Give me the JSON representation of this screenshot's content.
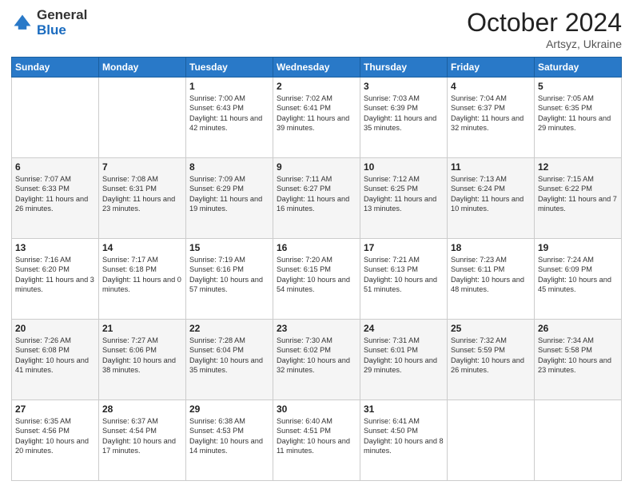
{
  "header": {
    "logo_general": "General",
    "logo_blue": "Blue",
    "month_title": "October 2024",
    "subtitle": "Artsyz, Ukraine"
  },
  "days_of_week": [
    "Sunday",
    "Monday",
    "Tuesday",
    "Wednesday",
    "Thursday",
    "Friday",
    "Saturday"
  ],
  "weeks": [
    [
      {
        "day": "",
        "sunrise": "",
        "sunset": "",
        "daylight": ""
      },
      {
        "day": "",
        "sunrise": "",
        "sunset": "",
        "daylight": ""
      },
      {
        "day": "1",
        "sunrise": "Sunrise: 7:00 AM",
        "sunset": "Sunset: 6:43 PM",
        "daylight": "Daylight: 11 hours and 42 minutes."
      },
      {
        "day": "2",
        "sunrise": "Sunrise: 7:02 AM",
        "sunset": "Sunset: 6:41 PM",
        "daylight": "Daylight: 11 hours and 39 minutes."
      },
      {
        "day": "3",
        "sunrise": "Sunrise: 7:03 AM",
        "sunset": "Sunset: 6:39 PM",
        "daylight": "Daylight: 11 hours and 35 minutes."
      },
      {
        "day": "4",
        "sunrise": "Sunrise: 7:04 AM",
        "sunset": "Sunset: 6:37 PM",
        "daylight": "Daylight: 11 hours and 32 minutes."
      },
      {
        "day": "5",
        "sunrise": "Sunrise: 7:05 AM",
        "sunset": "Sunset: 6:35 PM",
        "daylight": "Daylight: 11 hours and 29 minutes."
      }
    ],
    [
      {
        "day": "6",
        "sunrise": "Sunrise: 7:07 AM",
        "sunset": "Sunset: 6:33 PM",
        "daylight": "Daylight: 11 hours and 26 minutes."
      },
      {
        "day": "7",
        "sunrise": "Sunrise: 7:08 AM",
        "sunset": "Sunset: 6:31 PM",
        "daylight": "Daylight: 11 hours and 23 minutes."
      },
      {
        "day": "8",
        "sunrise": "Sunrise: 7:09 AM",
        "sunset": "Sunset: 6:29 PM",
        "daylight": "Daylight: 11 hours and 19 minutes."
      },
      {
        "day": "9",
        "sunrise": "Sunrise: 7:11 AM",
        "sunset": "Sunset: 6:27 PM",
        "daylight": "Daylight: 11 hours and 16 minutes."
      },
      {
        "day": "10",
        "sunrise": "Sunrise: 7:12 AM",
        "sunset": "Sunset: 6:25 PM",
        "daylight": "Daylight: 11 hours and 13 minutes."
      },
      {
        "day": "11",
        "sunrise": "Sunrise: 7:13 AM",
        "sunset": "Sunset: 6:24 PM",
        "daylight": "Daylight: 11 hours and 10 minutes."
      },
      {
        "day": "12",
        "sunrise": "Sunrise: 7:15 AM",
        "sunset": "Sunset: 6:22 PM",
        "daylight": "Daylight: 11 hours and 7 minutes."
      }
    ],
    [
      {
        "day": "13",
        "sunrise": "Sunrise: 7:16 AM",
        "sunset": "Sunset: 6:20 PM",
        "daylight": "Daylight: 11 hours and 3 minutes."
      },
      {
        "day": "14",
        "sunrise": "Sunrise: 7:17 AM",
        "sunset": "Sunset: 6:18 PM",
        "daylight": "Daylight: 11 hours and 0 minutes."
      },
      {
        "day": "15",
        "sunrise": "Sunrise: 7:19 AM",
        "sunset": "Sunset: 6:16 PM",
        "daylight": "Daylight: 10 hours and 57 minutes."
      },
      {
        "day": "16",
        "sunrise": "Sunrise: 7:20 AM",
        "sunset": "Sunset: 6:15 PM",
        "daylight": "Daylight: 10 hours and 54 minutes."
      },
      {
        "day": "17",
        "sunrise": "Sunrise: 7:21 AM",
        "sunset": "Sunset: 6:13 PM",
        "daylight": "Daylight: 10 hours and 51 minutes."
      },
      {
        "day": "18",
        "sunrise": "Sunrise: 7:23 AM",
        "sunset": "Sunset: 6:11 PM",
        "daylight": "Daylight: 10 hours and 48 minutes."
      },
      {
        "day": "19",
        "sunrise": "Sunrise: 7:24 AM",
        "sunset": "Sunset: 6:09 PM",
        "daylight": "Daylight: 10 hours and 45 minutes."
      }
    ],
    [
      {
        "day": "20",
        "sunrise": "Sunrise: 7:26 AM",
        "sunset": "Sunset: 6:08 PM",
        "daylight": "Daylight: 10 hours and 41 minutes."
      },
      {
        "day": "21",
        "sunrise": "Sunrise: 7:27 AM",
        "sunset": "Sunset: 6:06 PM",
        "daylight": "Daylight: 10 hours and 38 minutes."
      },
      {
        "day": "22",
        "sunrise": "Sunrise: 7:28 AM",
        "sunset": "Sunset: 6:04 PM",
        "daylight": "Daylight: 10 hours and 35 minutes."
      },
      {
        "day": "23",
        "sunrise": "Sunrise: 7:30 AM",
        "sunset": "Sunset: 6:02 PM",
        "daylight": "Daylight: 10 hours and 32 minutes."
      },
      {
        "day": "24",
        "sunrise": "Sunrise: 7:31 AM",
        "sunset": "Sunset: 6:01 PM",
        "daylight": "Daylight: 10 hours and 29 minutes."
      },
      {
        "day": "25",
        "sunrise": "Sunrise: 7:32 AM",
        "sunset": "Sunset: 5:59 PM",
        "daylight": "Daylight: 10 hours and 26 minutes."
      },
      {
        "day": "26",
        "sunrise": "Sunrise: 7:34 AM",
        "sunset": "Sunset: 5:58 PM",
        "daylight": "Daylight: 10 hours and 23 minutes."
      }
    ],
    [
      {
        "day": "27",
        "sunrise": "Sunrise: 6:35 AM",
        "sunset": "Sunset: 4:56 PM",
        "daylight": "Daylight: 10 hours and 20 minutes."
      },
      {
        "day": "28",
        "sunrise": "Sunrise: 6:37 AM",
        "sunset": "Sunset: 4:54 PM",
        "daylight": "Daylight: 10 hours and 17 minutes."
      },
      {
        "day": "29",
        "sunrise": "Sunrise: 6:38 AM",
        "sunset": "Sunset: 4:53 PM",
        "daylight": "Daylight: 10 hours and 14 minutes."
      },
      {
        "day": "30",
        "sunrise": "Sunrise: 6:40 AM",
        "sunset": "Sunset: 4:51 PM",
        "daylight": "Daylight: 10 hours and 11 minutes."
      },
      {
        "day": "31",
        "sunrise": "Sunrise: 6:41 AM",
        "sunset": "Sunset: 4:50 PM",
        "daylight": "Daylight: 10 hours and 8 minutes."
      },
      {
        "day": "",
        "sunrise": "",
        "sunset": "",
        "daylight": ""
      },
      {
        "day": "",
        "sunrise": "",
        "sunset": "",
        "daylight": ""
      }
    ]
  ]
}
